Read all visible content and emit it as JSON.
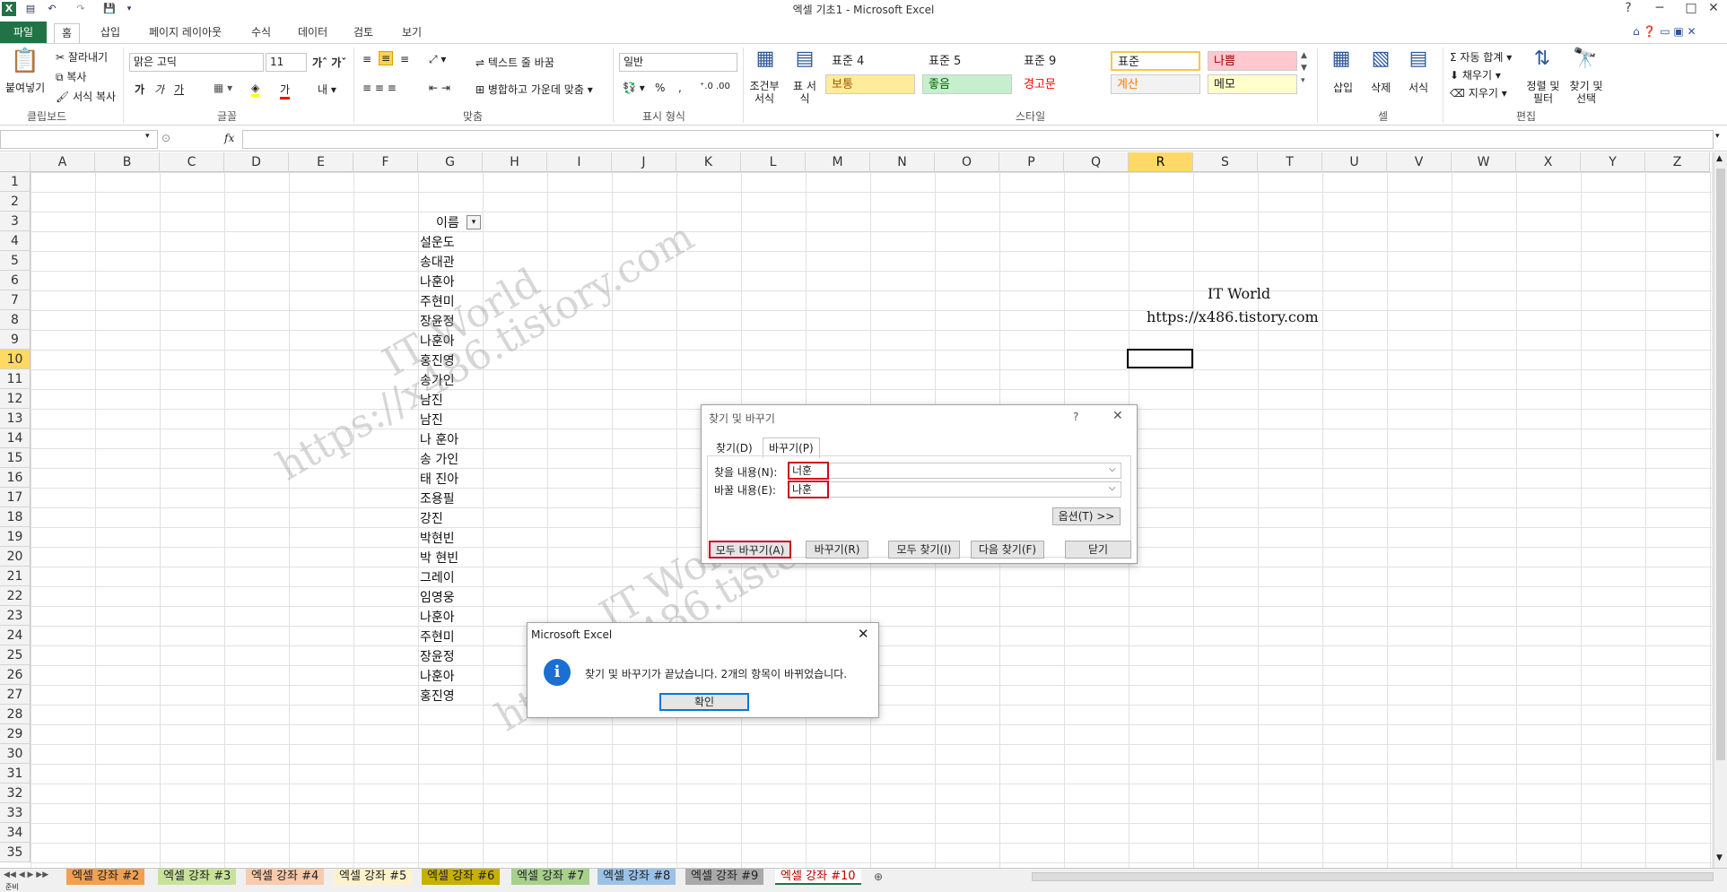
{
  "window": {
    "title": "엑셀 기초1  -  Microsoft Excel",
    "controls": [
      "?",
      "─",
      "□",
      "✕"
    ]
  },
  "ribbon_tabs": [
    "파일",
    "홈",
    "삽입",
    "페이지 레이아웃",
    "수식",
    "데이터",
    "검토",
    "보기"
  ],
  "ribbon": {
    "clipboard": {
      "paste": "붙여넣기",
      "cut": "잘라내기",
      "copy": "복사",
      "format_painter": "서식 복사",
      "label": "클립보드"
    },
    "font": {
      "name": "맑은 고딕",
      "size": "11",
      "label": "글꼴",
      "bold": "가",
      "italic": "가",
      "underline": "가"
    },
    "alignment": {
      "wrap_text": "텍스트 줄 바꿈",
      "merge_center": "병합하고 가운데 맞춤",
      "label": "맞춤"
    },
    "number": {
      "format": "일반",
      "percent": "%",
      "comma": ",",
      "label": "표시 형식"
    },
    "styles": {
      "conditional": "조건부 서식",
      "table": "표 서식",
      "label": "스타일",
      "cells": [
        {
          "text": "표준 4",
          "bg": "#ffffff",
          "color": "#222222"
        },
        {
          "text": "표준 5",
          "bg": "#ffffff",
          "color": "#222222"
        },
        {
          "text": "표준 9",
          "bg": "#ffffff",
          "color": "#222222"
        },
        {
          "text": "표준",
          "bg": "#ffffff",
          "color": "#222222"
        },
        {
          "text": "나쁨",
          "bg": "#ffc7ce",
          "color": "#9c0006"
        },
        {
          "text": "보통",
          "bg": "#ffeb9c",
          "color": "#9c5700"
        },
        {
          "text": "좋음",
          "bg": "#c6efce",
          "color": "#006100"
        },
        {
          "text": "경고문",
          "bg": "#ffffff",
          "color": "#ff0000"
        },
        {
          "text": "계산",
          "bg": "#f2f2f2",
          "color": "#fa7d00"
        },
        {
          "text": "메모",
          "bg": "#ffffcc",
          "color": "#222222"
        }
      ]
    },
    "cells": {
      "insert": "삽입",
      "delete": "삭제",
      "format": "서식",
      "label": "셀"
    },
    "editing": {
      "autosum": "자동 합계",
      "fill": "채우기",
      "clear": "지우기",
      "sort_filter": "정렬 및 필터",
      "find_select": "찾기 및 선택",
      "label": "편집"
    }
  },
  "formula_bar": {
    "fx": "fx",
    "name_box": "",
    "formula": ""
  },
  "columns": [
    "A",
    "B",
    "C",
    "D",
    "E",
    "F",
    "G",
    "H",
    "I",
    "J",
    "K",
    "L",
    "M",
    "N",
    "O",
    "P",
    "Q",
    "R",
    "S",
    "T",
    "U",
    "V",
    "W",
    "X",
    "Y",
    "Z"
  ],
  "selected_column": "R",
  "rows": [
    "1",
    "2",
    "3",
    "4",
    "5",
    "6",
    "7",
    "8",
    "9",
    "10",
    "11",
    "12",
    "13",
    "14",
    "15",
    "16",
    "17",
    "18",
    "19",
    "20",
    "21",
    "22",
    "23",
    "24",
    "25",
    "26",
    "27",
    "28",
    "29",
    "30",
    "31",
    "32",
    "33",
    "34",
    "35"
  ],
  "selected_row": "10",
  "table": {
    "header": "이름",
    "names": [
      "설운도",
      "송대관",
      "나훈아",
      "주현미",
      "장윤정",
      "나훈아",
      "홍진영",
      "송가인",
      "남진",
      "남진",
      "나 훈아",
      "송 가인",
      "태 진아",
      "조용필",
      "강진",
      "박현빈",
      "박 현빈",
      "그레이",
      "임영웅",
      "나훈아",
      "주현미",
      "장윤정",
      "나훈아",
      "홍진영"
    ]
  },
  "sheet_note": {
    "line1": "IT World",
    "line2": "https://x486.tistory.com"
  },
  "watermark": {
    "line1": "IT World",
    "line2": "https://x486.tistory.com"
  },
  "find_replace_dialog": {
    "title": "찾기 및 바꾸기",
    "tabs": [
      "찾기(D)",
      "바꾸기(P)"
    ],
    "find_label": "찾을 내용(N):",
    "find_value": "너훈",
    "replace_label": "바꿀 내용(E):",
    "replace_value": "나훈",
    "options_button": "옵션(T) >>",
    "buttons": [
      "모두 바꾸기(A)",
      "바꾸기(R)",
      "모두 찾기(I)",
      "다음 찾기(F)",
      "닫기"
    ],
    "help": "?",
    "close": "✕"
  },
  "message_box": {
    "title": "Microsoft Excel",
    "icon": "info-icon",
    "message": "찾기 및 바꾸기가 끝났습니다. 2개의 항목이 바뀌었습니다.",
    "ok": "확인",
    "close": "✕"
  },
  "sheet_tabs": [
    "엑셀 강좌 #2",
    "엑셀 강좌 #3",
    "엑셀 강좌 #4",
    "엑셀 강좌 #5",
    "엑셀 강좌 #6",
    "엑셀 강좌 #7",
    "엑셀 강좌 #8",
    "엑셀 강좌 #9",
    "엑셀 강좌 #10"
  ],
  "active_sheet": "엑셀 강좌 #10",
  "status": {
    "mode": "준비"
  },
  "colors": {
    "excel_green": "#217346",
    "selection_header": "#ffd966",
    "highlight_red": "#d0021b"
  }
}
